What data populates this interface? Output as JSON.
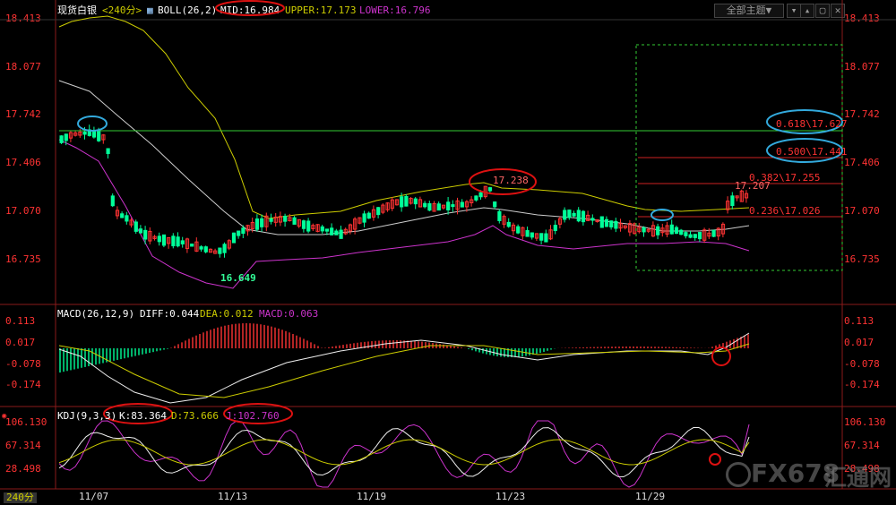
{
  "header": {
    "title": "现货白银",
    "period": "<240分>",
    "boll_label": "BOLL(26,2)",
    "mid": "MID:16.984",
    "upper": "UPPER:17.173",
    "lower": "LOWER:16.796",
    "theme_button": "全部主题▼"
  },
  "main_axis": [
    "18.413",
    "18.077",
    "17.742",
    "17.406",
    "17.070",
    "16.735"
  ],
  "annotations": {
    "low": "16.649",
    "high": "17.238",
    "last_high": "17.207"
  },
  "fib_levels": [
    {
      "label": "0.618\\17.627",
      "color": "#ff3333"
    },
    {
      "label": "0.500\\17.441",
      "color": "#ff3333"
    },
    {
      "label": "0.382\\17.255",
      "color": "#ff3333"
    },
    {
      "label": "0.236\\17.026",
      "color": "#ff3333"
    }
  ],
  "macd": {
    "label": "MACD(26,12,9)",
    "diff": "DIFF:0.044",
    "dea": "DEA:0.012",
    "macd": "MACD:0.063",
    "axis": [
      "0.113",
      "0.017",
      "-0.078",
      "-0.174"
    ]
  },
  "kdj": {
    "label": "KDJ(9,3,3)",
    "k": "K:83.364",
    "d": "D:73.666",
    "j": "J:102.760",
    "axis": [
      "106.130",
      "67.314",
      "28.498"
    ]
  },
  "x_axis": [
    "11/07",
    "11/13",
    "11/19",
    "11/23",
    "11/29"
  ],
  "period_tag": "240分",
  "watermark": {
    "brand": "FX678",
    "cn": "汇通网"
  },
  "colors": {
    "up": "#ff3333",
    "down": "#00ff99",
    "mid": "#cccccc",
    "upper": "#cccc00",
    "lower": "#cc33cc",
    "fib_line": "#33cc33"
  }
}
